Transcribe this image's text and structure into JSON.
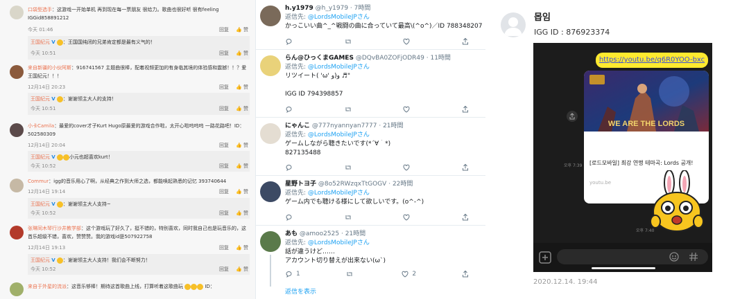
{
  "weibo": {
    "comments": [
      {
        "name": "口袋型选手",
        "text": "：这游戏一开始单机 再到现在每一票朋友 很给力。歌曲也很好听 很有feeling  IGGid858891212",
        "time": "今天 01:46",
        "reply": {
          "name": "王国纪元",
          "text": "：王国国纯闭的兄弟肯定都是最有义气的！",
          "time": "今天 10:51"
        }
      },
      {
        "name": "来自新疆的小伙阿斯",
        "text": "：916741567 主题曲很棒，配着视频更加的有身临其境的体验感和震撼！！？爱王国纪元！！！",
        "time": "12月14日 20:23",
        "reply": {
          "name": "王国纪元",
          "text": "：谢谢领主大人的支持！",
          "time": "今天 10:51"
        }
      },
      {
        "name": "小卡Camila",
        "text": "：最爱的cover才子Kurt Hugo原最爱的游戏合作啦，太开心啦呜呜呜 一路花路吧！ID：502580309",
        "time": "12月14日 20:04",
        "reply": {
          "name": "王国纪元",
          "text": "小元也超喜欢kurt！",
          "time": "今天 10:52"
        }
      },
      {
        "name": "Commur",
        "text": "：igg的音乐用心了啊，从经典之作到大师之选，都能唤起熟悉的记忆 393740644",
        "time": "12月14日 19:14",
        "reply": {
          "name": "王国纪元",
          "text": "：谢谢领主大人支持~",
          "time": "今天 10:52"
        }
      },
      {
        "name": "张琳同木琴行沙井教学部",
        "text": "：这个游戏玩了好久了，挺不错的，特别喜欢，同时我自己也是玩音乐的，这首乐超级不错，喜欢，赞赞赞。我的游戏id是507922758",
        "time": "12月14日 19:13",
        "reply": {
          "name": "王国纪元",
          "text": "：谢谢领主大人支持！我们会不断努力！",
          "time": "今天 10:52"
        }
      },
      {
        "name": "来自于外星的流派",
        "text": "：这音乐够棒！期待这首歌曲上线，打算听着这歌曲玩",
        "time": "",
        "reply": null
      }
    ],
    "reply_label": "回复",
    "like_label": "赞",
    "v_badge": "V",
    "ellipsis": "ID："
  },
  "twitter": {
    "reply_to_label": "返信先:",
    "reply_to_handle": "@LordsMobileJPさん",
    "tweets": [
      {
        "name": "h.y1979",
        "handle": "@h_y1979",
        "time": "7時間",
        "lines": [
          "かっこいい曲^_^戦闘の曲に合っていて最高\\(^o^)／ID 788348207"
        ],
        "replies": "",
        "retweets": "",
        "likes": ""
      },
      {
        "name": "らん@ひっくまGAMES",
        "handle": "@DQvBA0ZOFjODR49",
        "time": "11時間",
        "lines": [
          "リツイート( 'ω' و)و ♬\"",
          "",
          "IGG ID    794398857"
        ],
        "replies": "",
        "retweets": "",
        "likes": ""
      },
      {
        "name": "にゃんこ",
        "handle": "@777nyannyan7777",
        "time": "21時間",
        "lines": [
          "ゲームしながら聴きたいです(*´∀｀*)",
          "827135488"
        ],
        "replies": "",
        "retweets": "",
        "likes": ""
      },
      {
        "name": "星野トヨ子",
        "handle": "@8o52RWzqxTtGOGV",
        "time": "22時間",
        "lines": [
          "ゲーム内でも聴ける様にして欲しいです。(o^-^)"
        ],
        "replies": "",
        "retweets": "",
        "likes": ""
      },
      {
        "name": "あも",
        "handle": "@amoo2525",
        "time": "21時間",
        "lines": [
          "話が違うけど……",
          "アカウント切り替えが出来ない(ω`)"
        ],
        "replies": "1",
        "retweets": "",
        "likes": "2"
      }
    ],
    "show_more": "返信を表示"
  },
  "kakao_post": {
    "username": "몹임",
    "igg_id": "IGG ID : 876923374",
    "chat": {
      "link_text": "https://youtu.be/q6R0YOO-bxc",
      "card_banner": "WE ARE THE LORDS",
      "card_title": "[로드모바일] 최강 연맹 테마곡: Lords 공개!",
      "card_url": "youtu.be",
      "time_card": "오후 7:39",
      "time_sticker": "오후 7:40"
    },
    "date": "2020.12.14. 19:44"
  },
  "colors": {
    "weibo_name": "#eb7350",
    "twitter_blue": "#1da1f2",
    "kakao_yellow": "#ffea2f"
  }
}
